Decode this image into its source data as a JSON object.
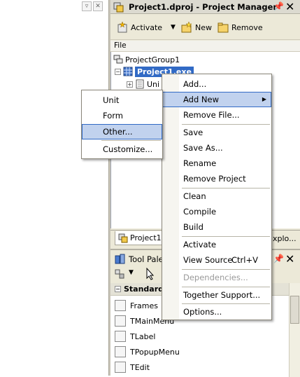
{
  "project_manager": {
    "title": "Project1.dproj - Project Manager",
    "toolbar": {
      "activate": "Activate",
      "new": "New",
      "remove": "Remove"
    },
    "file_header": "File",
    "tree": {
      "group": "ProjectGroup1",
      "project": "Project1.exe",
      "unit_partial": "Uni"
    },
    "tabs": {
      "project_tab": "Project1.",
      "explorer_tab": "xplo..."
    }
  },
  "tool_palette": {
    "title": "Tool Palet",
    "category": "Standard",
    "items": [
      "Frames",
      "TMainMenu",
      "TLabel",
      "TPopupMenu",
      "TEdit"
    ]
  },
  "context_menu": {
    "items": [
      {
        "label": "Add..."
      },
      {
        "label": "Add New"
      },
      {
        "label": "Remove File..."
      },
      {
        "label": "Save"
      },
      {
        "label": "Save As..."
      },
      {
        "label": "Rename"
      },
      {
        "label": "Remove Project"
      },
      {
        "label": "Clean"
      },
      {
        "label": "Compile"
      },
      {
        "label": "Build"
      },
      {
        "label": "Activate"
      },
      {
        "label": "View Source",
        "shortcut": "Ctrl+V"
      },
      {
        "label": "Dependencies..."
      },
      {
        "label": "Together Support..."
      },
      {
        "label": "Options..."
      }
    ]
  },
  "add_new_submenu": {
    "items": [
      "Unit",
      "Form",
      "Other...",
      "Customize..."
    ]
  },
  "colors": {
    "selection": "#316ac5",
    "menu_highlight": "#c1d2ee",
    "panel": "#ece9d8"
  }
}
